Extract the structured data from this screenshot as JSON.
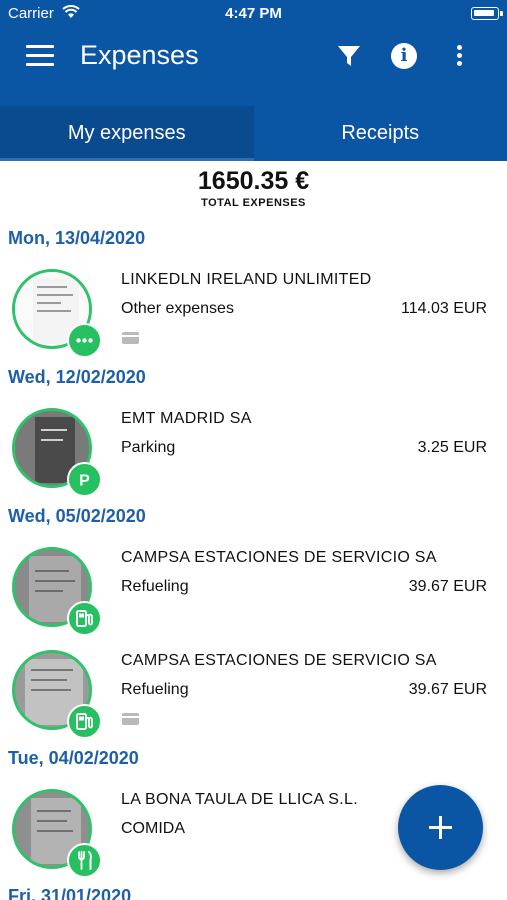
{
  "status_bar": {
    "carrier": "Carrier",
    "time": "4:47 PM"
  },
  "app_bar": {
    "title": "Expenses",
    "icons": [
      "menu-icon",
      "filter-icon",
      "info-icon",
      "more-vert-icon"
    ]
  },
  "tabs": [
    {
      "label": "My expenses",
      "active": true
    },
    {
      "label": "Receipts",
      "active": false
    }
  ],
  "total": {
    "amount": "1650.35 €",
    "label": "TOTAL EXPENSES"
  },
  "groups": [
    {
      "date": "Mon, 13/04/2020"
    },
    {
      "date": "Wed, 12/02/2020"
    },
    {
      "date": "Wed, 05/02/2020"
    },
    {
      "date": "Tue, 04/02/2020"
    },
    {
      "date": "Fri, 31/01/2020"
    }
  ],
  "expenses": [
    {
      "merchant": "LINKEDLN IRELAND UNLIMITED",
      "category": "Other expenses",
      "amount": "114.03 EUR",
      "badge_icon": "more-horiz-icon",
      "card": true
    },
    {
      "merchant": "EMT MADRID SA",
      "category": "Parking",
      "amount": "3.25 EUR",
      "badge_icon": "parking-icon",
      "card": false
    },
    {
      "merchant": "CAMPSA ESTACIONES DE SERVICIO SA",
      "category": "Refueling",
      "amount": "39.67 EUR",
      "badge_icon": "fuel-pump-icon",
      "card": false
    },
    {
      "merchant": "CAMPSA ESTACIONES DE SERVICIO SA",
      "category": "Refueling",
      "amount": "39.67 EUR",
      "badge_icon": "fuel-pump-icon",
      "card": true
    },
    {
      "merchant": "LA BONA TAULA DE LLICA S.L.",
      "category": "COMIDA",
      "amount": "",
      "badge_icon": "restaurant-icon",
      "card": false
    }
  ],
  "colors": {
    "primary": "#0b56a4",
    "badge_green": "#27c061",
    "date_blue": "#1d5fa8"
  }
}
